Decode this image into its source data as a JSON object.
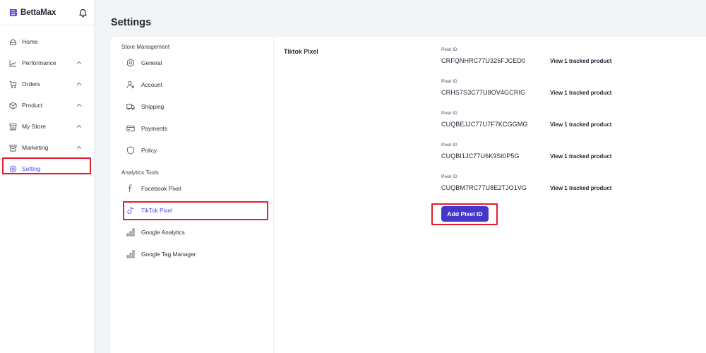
{
  "app": {
    "brand": "BettaMax",
    "brand_color": "#4f46e5",
    "notification_icon": "bell-icon"
  },
  "sidebar": {
    "items": [
      {
        "label": "Home",
        "icon": "home-icon",
        "expandable": false,
        "active": false
      },
      {
        "label": "Performance",
        "icon": "chart-icon",
        "expandable": true,
        "active": false
      },
      {
        "label": "Orders",
        "icon": "cart-icon",
        "expandable": true,
        "active": false
      },
      {
        "label": "Product",
        "icon": "box-icon",
        "expandable": true,
        "active": false
      },
      {
        "label": "My Store",
        "icon": "store-icon",
        "expandable": true,
        "active": false
      },
      {
        "label": "Marketing",
        "icon": "megaphone-icon",
        "expandable": true,
        "active": false
      },
      {
        "label": "Setting",
        "icon": "gear-icon",
        "expandable": false,
        "active": true
      }
    ]
  },
  "page": {
    "title": "Settings"
  },
  "settings_menu": {
    "store_management": {
      "heading": "Store Management",
      "items": [
        {
          "label": "General",
          "icon": "gear-icon"
        },
        {
          "label": "Account",
          "icon": "user-icon"
        },
        {
          "label": "Shipping",
          "icon": "truck-icon"
        },
        {
          "label": "Payments",
          "icon": "card-icon"
        },
        {
          "label": "Policy",
          "icon": "shield-icon"
        }
      ]
    },
    "analytics_tools": {
      "heading": "Analytics Tools",
      "items": [
        {
          "label": "Facebook Pixel",
          "icon": "facebook-icon",
          "active": false
        },
        {
          "label": "TikTok Pixel",
          "icon": "tiktok-icon",
          "active": true
        },
        {
          "label": "Google Analytics",
          "icon": "bar-chart-icon",
          "active": false
        },
        {
          "label": "Google Tag Manager",
          "icon": "bar-chart-icon",
          "active": false
        }
      ]
    }
  },
  "content": {
    "title": "Tiktok Pixel",
    "pixels": [
      {
        "label": "Pixel ID",
        "id": "CRFQNHRC77U326FJCED0",
        "link": "View 1 tracked product"
      },
      {
        "label": "Pixel ID",
        "id": "CRHS7S3C77U8OV4GCRIG",
        "link": "View 1 tracked product"
      },
      {
        "label": "Pixel ID",
        "id": "CUQBEJJC77U7F7KCGGMG",
        "link": "View 1 tracked product"
      },
      {
        "label": "Pixel ID",
        "id": "CUQBI1JC77U6K9SI0P5G",
        "link": "View 1 tracked product"
      },
      {
        "label": "Pixel ID",
        "id": "CUQBM7RC77U8E2TJO1VG",
        "link": "View 1 tracked product"
      }
    ],
    "add_button": "Add Pixel ID",
    "button_color": "#4338ca"
  },
  "highlight_color": "#e11d2e"
}
